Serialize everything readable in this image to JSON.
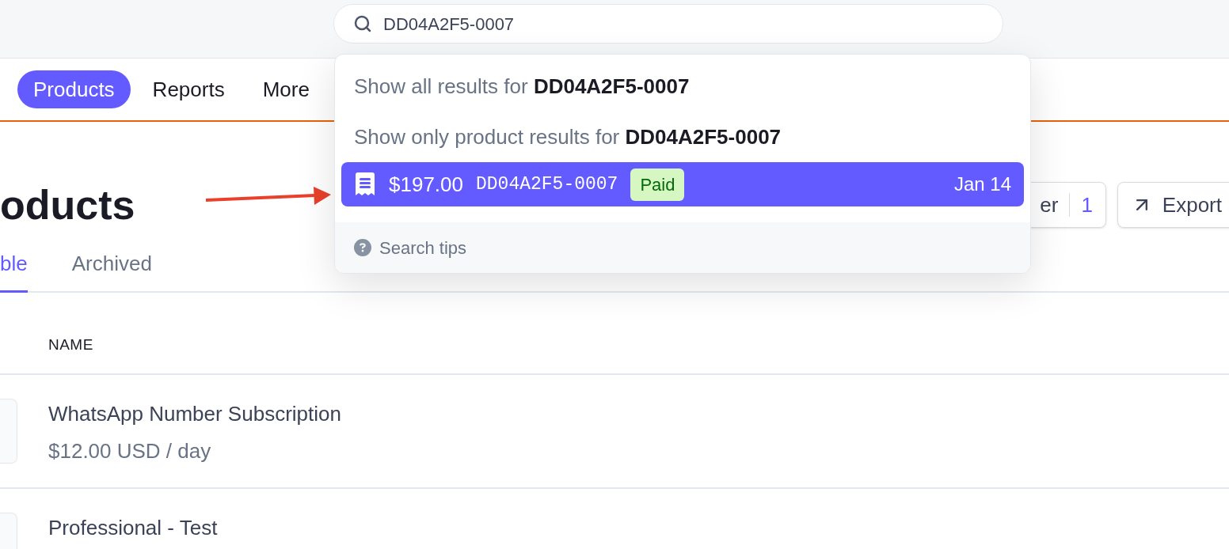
{
  "search": {
    "value": "DD04A2F5-0007"
  },
  "nav": {
    "items": [
      {
        "label": "Products",
        "selected": true
      },
      {
        "label": "Reports",
        "selected": false
      },
      {
        "label": "More",
        "selected": false
      }
    ]
  },
  "page": {
    "title": "oducts",
    "filter": {
      "label": "er",
      "count": "1"
    },
    "export": {
      "label": "Export"
    },
    "tabs": [
      {
        "label": "ble",
        "selected": true
      },
      {
        "label": "Archived",
        "selected": false
      }
    ]
  },
  "table": {
    "columns": [
      "NAME"
    ],
    "rows": [
      {
        "name": "WhatsApp Number Subscription",
        "price": "$12.00 USD / day"
      },
      {
        "name": "Professional - Test"
      }
    ]
  },
  "dropdown": {
    "options": [
      {
        "text": "Show all results for **DD04A2F5-0007**"
      },
      {
        "text": "Show only product results for **DD04A2F5-0007**"
      }
    ],
    "results": [
      {
        "amount": "$197.00",
        "id": "DD04A2F5-0007",
        "status": "Paid",
        "date": "Jan 14",
        "selected": true
      }
    ],
    "footer": "Search tips"
  }
}
